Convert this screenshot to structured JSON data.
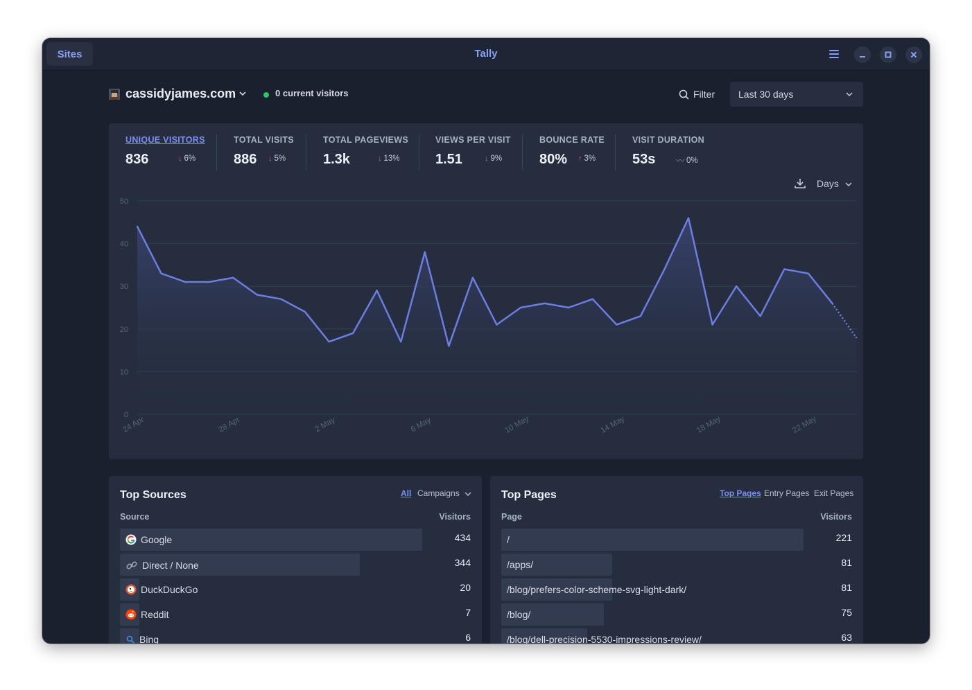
{
  "titlebar": {
    "sites_label": "Sites",
    "title": "Tally"
  },
  "header": {
    "site_name": "cassidyjames.com",
    "live_visitors": "0 current visitors",
    "filter_label": "Filter",
    "date_range": "Last 30 days"
  },
  "stats": [
    {
      "label": "UNIQUE VISITORS",
      "value": "836",
      "change": "6%",
      "direction": "down",
      "active": true
    },
    {
      "label": "TOTAL VISITS",
      "value": "886",
      "change": "5%",
      "direction": "down",
      "active": false
    },
    {
      "label": "TOTAL PAGEVIEWS",
      "value": "1.3k",
      "change": "13%",
      "direction": "down",
      "active": false
    },
    {
      "label": "VIEWS PER VISIT",
      "value": "1.51",
      "change": "9%",
      "direction": "down",
      "active": false
    },
    {
      "label": "BOUNCE RATE",
      "value": "80%",
      "change": "3%",
      "direction": "up",
      "active": false
    },
    {
      "label": "VISIT DURATION",
      "value": "53s",
      "change": "0%",
      "direction": "flat",
      "active": false
    }
  ],
  "chart_controls": {
    "interval": "Days"
  },
  "chart_data": {
    "type": "area",
    "title": "",
    "xlabel": "",
    "ylabel": "",
    "ylim": [
      0,
      50
    ],
    "yticks": [
      "0",
      "10",
      "20",
      "30",
      "40",
      "50"
    ],
    "xticks": [
      "24 Apr",
      "28 Apr",
      "2 May",
      "6 May",
      "10 May",
      "14 May",
      "18 May",
      "22 May"
    ],
    "x": [
      "24 Apr",
      "25 Apr",
      "26 Apr",
      "27 Apr",
      "28 Apr",
      "29 Apr",
      "30 Apr",
      "1 May",
      "2 May",
      "3 May",
      "4 May",
      "5 May",
      "6 May",
      "7 May",
      "8 May",
      "9 May",
      "10 May",
      "11 May",
      "12 May",
      "13 May",
      "14 May",
      "15 May",
      "16 May",
      "17 May",
      "18 May",
      "19 May",
      "20 May",
      "21 May",
      "22 May",
      "23 May",
      "24 May"
    ],
    "series": [
      {
        "values": [
          44,
          33,
          31,
          31,
          32,
          28,
          27,
          24,
          17,
          19,
          29,
          17,
          38,
          16,
          32,
          21,
          25,
          26,
          25,
          27,
          21,
          23,
          34,
          46,
          21,
          30,
          23,
          34,
          33,
          26,
          18
        ]
      }
    ],
    "grid": true,
    "last_segment_dotted": true,
    "colors": {
      "line": "#6c7ee0",
      "fill_top": "#3a4470",
      "grid": "#333c50",
      "tick": "#596275"
    }
  },
  "top_sources": {
    "title": "Top Sources",
    "tabs": [
      "All",
      "Campaigns"
    ],
    "col_source": "Source",
    "col_visitors": "Visitors",
    "max": 434,
    "rows": [
      {
        "label": "Google",
        "value": "434",
        "num": 434,
        "icon": "google-icon"
      },
      {
        "label": "Direct / None",
        "value": "344",
        "num": 344,
        "icon": "link-icon"
      },
      {
        "label": "DuckDuckGo",
        "value": "20",
        "num": 20,
        "icon": "duckduckgo-icon"
      },
      {
        "label": "Reddit",
        "value": "7",
        "num": 7,
        "icon": "reddit-icon"
      },
      {
        "label": "Bing",
        "value": "6",
        "num": 6,
        "icon": "bing-icon"
      }
    ]
  },
  "top_pages": {
    "title": "Top Pages",
    "tabs": [
      "Top Pages",
      "Entry Pages",
      "Exit Pages"
    ],
    "col_page": "Page",
    "col_visitors": "Visitors",
    "max": 221,
    "rows": [
      {
        "label": "/",
        "value": "221",
        "num": 221
      },
      {
        "label": "/apps/",
        "value": "81",
        "num": 81
      },
      {
        "label": "/blog/prefers-color-scheme-svg-light-dark/",
        "value": "81",
        "num": 81
      },
      {
        "label": "/blog/",
        "value": "75",
        "num": 75
      },
      {
        "label": "/blog/dell-precision-5530-impressions-review/",
        "value": "63",
        "num": 63
      }
    ]
  }
}
